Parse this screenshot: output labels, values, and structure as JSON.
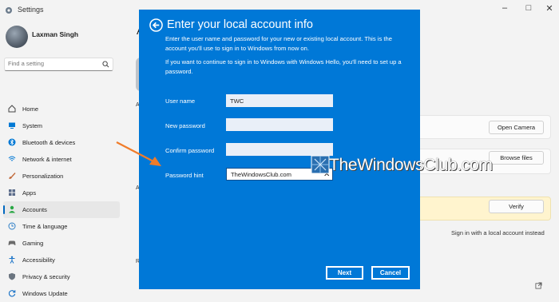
{
  "app": {
    "title": "Settings"
  },
  "sidebar": {
    "user_name": "Laxman Singh",
    "search_placeholder": "Find a setting",
    "items": [
      {
        "label": "Home",
        "icon": "home-icon",
        "color": "#444444"
      },
      {
        "label": "System",
        "icon": "monitor-icon",
        "color": "#0078d4"
      },
      {
        "label": "Bluetooth & devices",
        "icon": "bluetooth-icon",
        "color": "#0078d4"
      },
      {
        "label": "Network & internet",
        "icon": "wifi-icon",
        "color": "#0078d4"
      },
      {
        "label": "Personalization",
        "icon": "brush-icon",
        "color": "#c1693a"
      },
      {
        "label": "Apps",
        "icon": "apps-icon",
        "color": "#5a6b8a"
      },
      {
        "label": "Accounts",
        "icon": "person-icon",
        "color": "#2aa745"
      },
      {
        "label": "Time & language",
        "icon": "globe-clock-icon",
        "color": "#2f7fc7"
      },
      {
        "label": "Gaming",
        "icon": "gamepad-icon",
        "color": "#6a6a6a"
      },
      {
        "label": "Accessibility",
        "icon": "accessibility-icon",
        "color": "#1a73c7"
      },
      {
        "label": "Privacy & security",
        "icon": "shield-icon",
        "color": "#6b7580"
      },
      {
        "label": "Windows Update",
        "icon": "update-icon",
        "color": "#1a73c7"
      }
    ],
    "active_index": 6
  },
  "content": {
    "partial_heading": "A",
    "partial_row_a": "A",
    "partial_row_b": "A",
    "partial_row_r": "R",
    "open_camera_label": "Open Camera",
    "browse_files_label": "Browse files",
    "verify_label": "Verify",
    "local_account_link": "Sign in with a local account instead"
  },
  "dialog": {
    "title": "Enter your local account info",
    "para1": "Enter the user name and password for your new or existing local account. This is the account you'll use to sign in to Windows from now on.",
    "para2": "If you want to continue to sign in to Windows with Windows Hello, you'll need to set up a password.",
    "fields": {
      "username": {
        "label": "User name",
        "value": "TWC"
      },
      "new_password": {
        "label": "New password",
        "value": ""
      },
      "confirm_password": {
        "label": "Confirm password",
        "value": ""
      },
      "password_hint": {
        "label": "Password hint",
        "value": "TheWindowsClub.com"
      }
    },
    "next_label": "Next",
    "cancel_label": "Cancel",
    "accent_color": "#0078d7"
  },
  "watermark": {
    "text": "TheWindowsClub.com"
  },
  "annotation": {
    "arrow_color": "#f07c2a"
  }
}
